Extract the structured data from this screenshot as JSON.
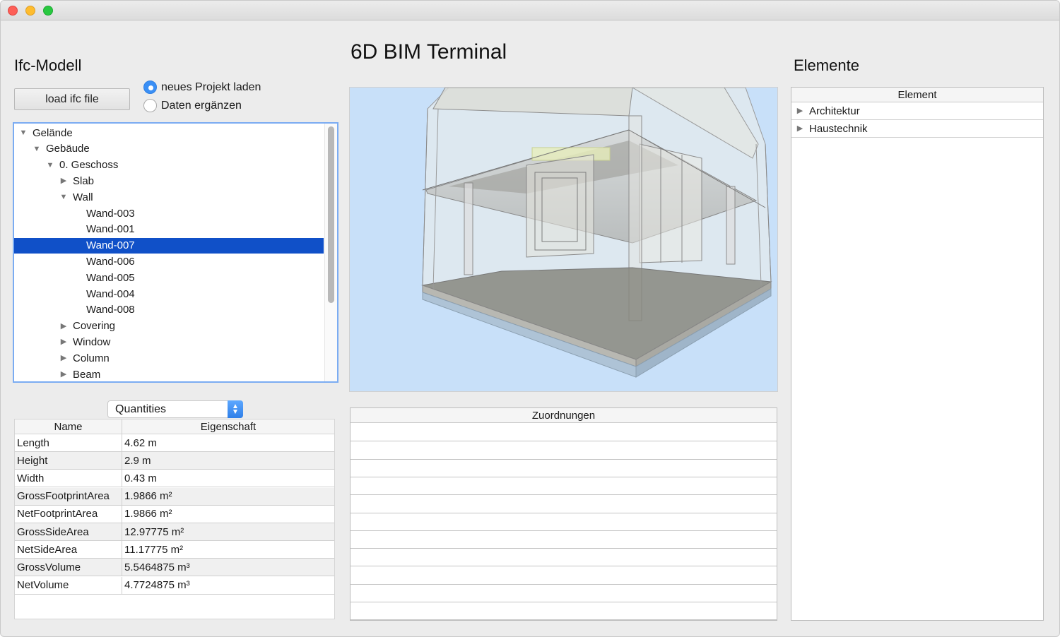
{
  "app": {
    "main_title": "6D BIM Terminal"
  },
  "left": {
    "title": "Ifc-Modell",
    "load_button": "load ifc file",
    "radios": [
      {
        "label": "neues Projekt laden",
        "checked": true
      },
      {
        "label": "Daten ergänzen",
        "checked": false
      }
    ],
    "tree": [
      {
        "label": "Gelände",
        "level": 0,
        "expander": "expanded",
        "selected": false
      },
      {
        "label": "Gebäude",
        "level": 1,
        "expander": "expanded",
        "selected": false
      },
      {
        "label": "0. Geschoss",
        "level": 2,
        "expander": "expanded",
        "selected": false
      },
      {
        "label": "Slab",
        "level": 3,
        "expander": "collapsed",
        "selected": false
      },
      {
        "label": "Wall",
        "level": 3,
        "expander": "expanded",
        "selected": false
      },
      {
        "label": "Wand-003",
        "level": 4,
        "expander": "none",
        "selected": false
      },
      {
        "label": "Wand-001",
        "level": 4,
        "expander": "none",
        "selected": false
      },
      {
        "label": "Wand-007",
        "level": 4,
        "expander": "none",
        "selected": true
      },
      {
        "label": "Wand-006",
        "level": 4,
        "expander": "none",
        "selected": false
      },
      {
        "label": "Wand-005",
        "level": 4,
        "expander": "none",
        "selected": false
      },
      {
        "label": "Wand-004",
        "level": 4,
        "expander": "none",
        "selected": false
      },
      {
        "label": "Wand-008",
        "level": 4,
        "expander": "none",
        "selected": false
      },
      {
        "label": "Covering",
        "level": 3,
        "expander": "collapsed",
        "selected": false
      },
      {
        "label": "Window",
        "level": 3,
        "expander": "collapsed",
        "selected": false
      },
      {
        "label": "Column",
        "level": 3,
        "expander": "collapsed",
        "selected": false
      },
      {
        "label": "Beam",
        "level": 3,
        "expander": "collapsed",
        "selected": false
      }
    ],
    "quantity_select": "Quantities",
    "table": {
      "headers": [
        "Name",
        "Eigenschaft"
      ],
      "rows": [
        [
          "Length",
          "4.62 m"
        ],
        [
          "Height",
          "2.9 m"
        ],
        [
          "Width",
          "0.43 m"
        ],
        [
          "GrossFootprintArea",
          "1.9866 m²"
        ],
        [
          "NetFootprintArea",
          "1.9866 m²"
        ],
        [
          "GrossSideArea",
          "12.97775 m²"
        ],
        [
          "NetSideArea",
          "11.17775 m²"
        ],
        [
          "GrossVolume",
          "5.5464875 m³"
        ],
        [
          "NetVolume",
          "4.7724875 m³"
        ]
      ]
    }
  },
  "center": {
    "assignments_header": "Zuordnungen",
    "assignment_rows": 11
  },
  "right": {
    "title": "Elemente",
    "header": "Element",
    "items": [
      {
        "label": "Architektur"
      },
      {
        "label": "Haustechnik"
      }
    ]
  },
  "colors": {
    "selection": "#1050c8",
    "accent": "#3a8ff5",
    "viewer_bg": "#c8e0f9"
  },
  "icons": {
    "expanded": "triangle-down-icon",
    "collapsed": "triangle-right-icon"
  }
}
